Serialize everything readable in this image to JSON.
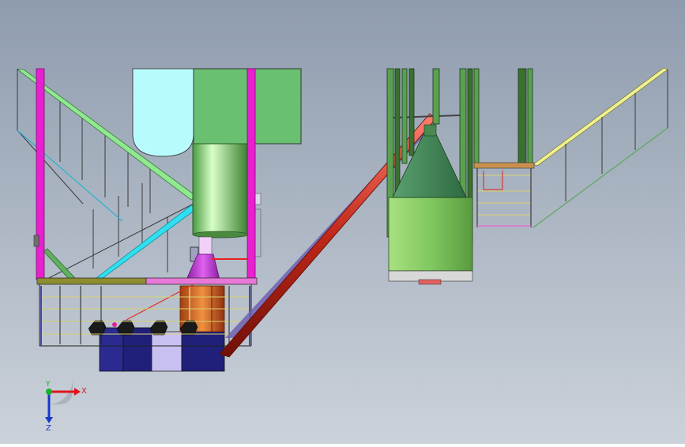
{
  "viewport": {
    "background_top": "#8f9cae",
    "background_bottom": "#c9d0d9"
  },
  "triad": {
    "x_label": "X",
    "y_label": "Y",
    "z_label": "Z",
    "x_color": "#e0141c",
    "y_color": "#16b02a",
    "z_color": "#1838c8"
  },
  "colors": {
    "magenta": "#e820d0",
    "green_bin": "#68c070",
    "light_cyan": "#b8fbff",
    "cyan_brace": "#30e0f0",
    "light_green_brace": "#90e890",
    "red_conveyor": "#c8281c",
    "olive_platform": "#8c8c30",
    "navy": "#20207a",
    "silo_green": "#7cc860",
    "cone_green": "#3c8850",
    "yellow_rail": "#f0f090"
  }
}
